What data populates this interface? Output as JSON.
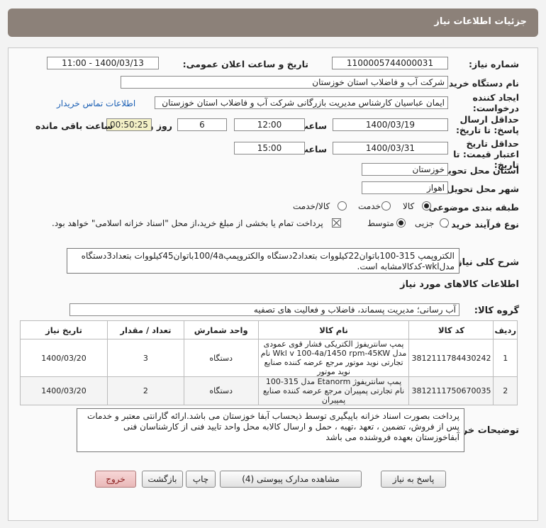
{
  "header": {
    "title": "جزئیات اطلاعات نیاز"
  },
  "watermark": "ParsNamadData",
  "fields": {
    "need_number_label": "شماره نیاز:",
    "need_number": "1100005744000031",
    "announce_label": "تاریخ و ساعت اعلان عمومی:",
    "announce_value": "1400/03/13 - 11:00",
    "buyer_label": "نام دستگاه خریدار:",
    "buyer_value": "شرکت آب و فاضلاب استان خوزستان",
    "creator_label": "ایجاد کننده درخواست:",
    "creator_value": "ایمان عباسیان کارشناس مدیریت بازرگانی شرکت آب و فاضلاب استان خوزستان",
    "contact_link": "اطلاعات تماس خریدار",
    "deadline_label": "حداقل ارسال پاسخ: تا تاریخ:",
    "deadline_date": "1400/03/19",
    "time_label": "ساعت",
    "deadline_time": "12:00",
    "days_value": "6",
    "days_label": "روز و",
    "remaining_timer": "00:50:25",
    "remaining_label": "ساعت باقی مانده",
    "validity_label": "حداقل تاریخ اعتبار قیمت: تا تاریخ:",
    "validity_date": "1400/03/31",
    "validity_time": "15:00",
    "province_label": "استان محل تحویل:",
    "province_value": "خوزستان",
    "city_label": "شهر محل تحویل:",
    "city_value": "اهواز",
    "category_label": "طبقه بندی موضوعی:",
    "category_options": [
      "کالا",
      "خدمت",
      "کالا/خدمت"
    ],
    "category_selected": 0,
    "process_label": "نوع فرآیند خرید :",
    "process_options": [
      "جزیی",
      "متوسط"
    ],
    "process_selected": 1,
    "payment_note": "پرداخت تمام یا بخشی از مبلغ خرید،از محل \"اسناد خزانه اسلامی\" خواهد بود."
  },
  "summary": {
    "label": "شرح کلی نیاز:",
    "text": "الکتروپمپ 315-100باتوان22کیلووات بتعداد2دستگاه والکتروپمپ100/4aباتوان45کیلووات بتعداد3دستگاه مدلwkl-کدکالامشابه است."
  },
  "goods_section": {
    "title": "اطلاعات کالاهای مورد نیاز"
  },
  "group": {
    "label": "گروه کالا:",
    "value": "آب رسانی؛ مدیریت پسماند، فاضلاب و فعالیت های تصفیه"
  },
  "table": {
    "headers": [
      "ردیف",
      "کد کالا",
      "نام کالا",
      "واحد شمارش",
      "تعداد / مقدار",
      "تاریخ نیاز"
    ],
    "rows": [
      {
        "index": "1",
        "code": "3812111784430242",
        "name": "پمپ سانتریفوژ الکتریکی فشار قوی عمودی مدل Wkl v 100-4a/1450 rpm-45KW نام تجارتی نوید موتور مرجع عرضه کننده صنایع نوید موتور",
        "unit": "دستگاه",
        "qty": "3",
        "date": "1400/03/20"
      },
      {
        "index": "2",
        "code": "3812111750670035",
        "name": "پمپ سانتریفوژ Etanorm مدل 315-100 نام تجارتی پمپیران مرجع عرضه کننده صنایع پمپیران",
        "unit": "دستگاه",
        "qty": "2",
        "date": "1400/03/20"
      }
    ]
  },
  "buyer_notes": {
    "label": "توضیحات خریدار:",
    "text": "پرداخت بصورت اسناد خزانه باپیگیری توسط ذیحساب آبفا خوزستان می باشد.ارائه گارانتی معتبر و خدمات پس از فروش، تضمین ، تعهد ،تهیه ، حمل و ارسال کالابه محل واحد تایید فنی از کارشناسان فنی آبفاخوزستان بعهده فروشنده می باشد"
  },
  "buttons": {
    "reply": "پاسخ به نیاز",
    "attachments": "مشاهده مدارک پیوستی (4)",
    "print": "چاپ",
    "back": "بازگشت",
    "exit": "خروج"
  }
}
